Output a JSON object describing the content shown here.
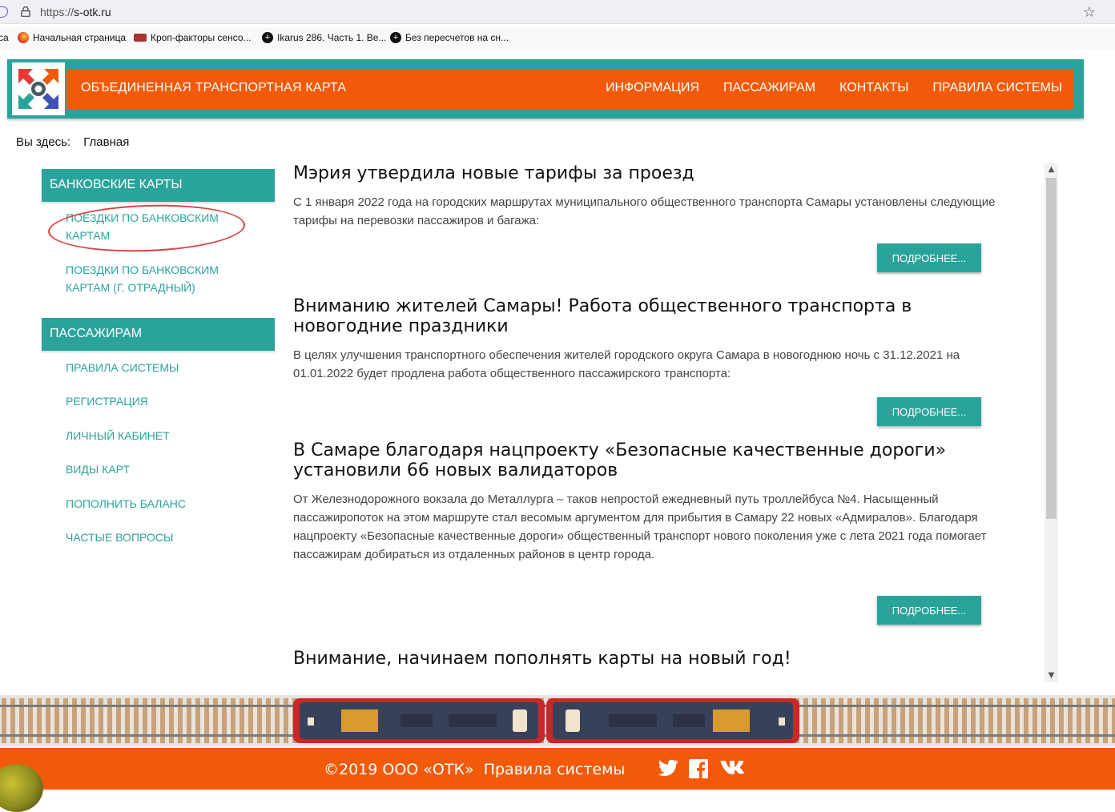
{
  "browser": {
    "url_prefix": "https://",
    "url_host": "s-otk.ru",
    "bookmarks": [
      {
        "label": "са"
      },
      {
        "label": "Начальная страница"
      },
      {
        "label": "Кроп-факторы сенсо..."
      },
      {
        "label": "Ikarus 286. Часть 1. Ве..."
      },
      {
        "label": "Без пересчетов на сн..."
      }
    ]
  },
  "header": {
    "brand": "ОБЪЕДИНЕННАЯ ТРАНСПОРТНАЯ КАРТА",
    "nav": [
      "ИНФОРМАЦИЯ",
      "ПАССАЖИРАМ",
      "КОНТАКТЫ",
      "ПРАВИЛА СИСТЕМЫ"
    ]
  },
  "breadcrumb": {
    "label": "Вы здесь:",
    "current": "Главная"
  },
  "sidebar": {
    "sections": [
      {
        "title": "БАНКОВСКИЕ КАРТЫ",
        "items": [
          {
            "label": "ПОЕЗДКИ ПО БАНКОВСКИМ КАРТАМ"
          },
          {
            "label": "ПОЕЗДКИ ПО БАНКОВСКИМ КАРТАМ (Г. ОТРАДНЫЙ)"
          }
        ]
      },
      {
        "title": "ПАССАЖИРАМ",
        "items": [
          {
            "label": "ПРАВИЛА СИСТЕМЫ"
          },
          {
            "label": "РЕГИСТРАЦИЯ"
          },
          {
            "label": "ЛИЧНЫЙ КАБИНЕТ"
          },
          {
            "label": "ВИДЫ КАРТ"
          },
          {
            "label": "ПОПОЛНИТЬ БАЛАНС"
          },
          {
            "label": "ЧАСТЫЕ ВОПРОСЫ"
          }
        ]
      }
    ]
  },
  "articles": [
    {
      "title": "Мэрия утвердила новые тарифы за проезд",
      "text": "С 1 января 2022 года на городских маршрутах муниципального общественного транспорта Самары установлены следующие тарифы на перевозки пассажиров и багажа:",
      "more": "ПОДРОБНЕЕ..."
    },
    {
      "title": "Вниманию жителей Самары! Работа общественного транспорта в новогодние праздники",
      "text": "В целях улучшения транспортного обеспечения жителей городского округа Самара в новогоднюю ночь с 31.12.2021 на 01.01.2022 будет продлена работа общественного пассажирского транспорта:",
      "more": "ПОДРОБНЕЕ..."
    },
    {
      "title": "В Самаре благодаря нацпроекту «Безопасные качественные дороги» установили 66 новых валидаторов",
      "text": "От Железнодорожного вокзала до Металлурга – таков непростой ежедневный путь троллейбуса №4. Насыщенный пассажиропоток на этом маршруте стал весомым аргументом для прибытия в Самару 22 новых «Адмиралов». Благодаря нацпроекту «Безопасные качественные дороги» общественный транспорт нового поколения уже с лета 2021 года помогает пассажирам добираться из отдаленных районов в центр города.",
      "more": "ПОДРОБНЕЕ..."
    },
    {
      "title": "Внимание, начинаем пополнять карты на новый год!"
    }
  ],
  "footer": {
    "copyright": "©2019 ООО «ОТК»",
    "rules_link": "Правила системы",
    "social": [
      "twitter-icon",
      "facebook-icon",
      "vk-icon"
    ]
  },
  "colors": {
    "teal": "#2aa49a",
    "orange": "#f25a0a",
    "annotation_red": "#d64545"
  }
}
